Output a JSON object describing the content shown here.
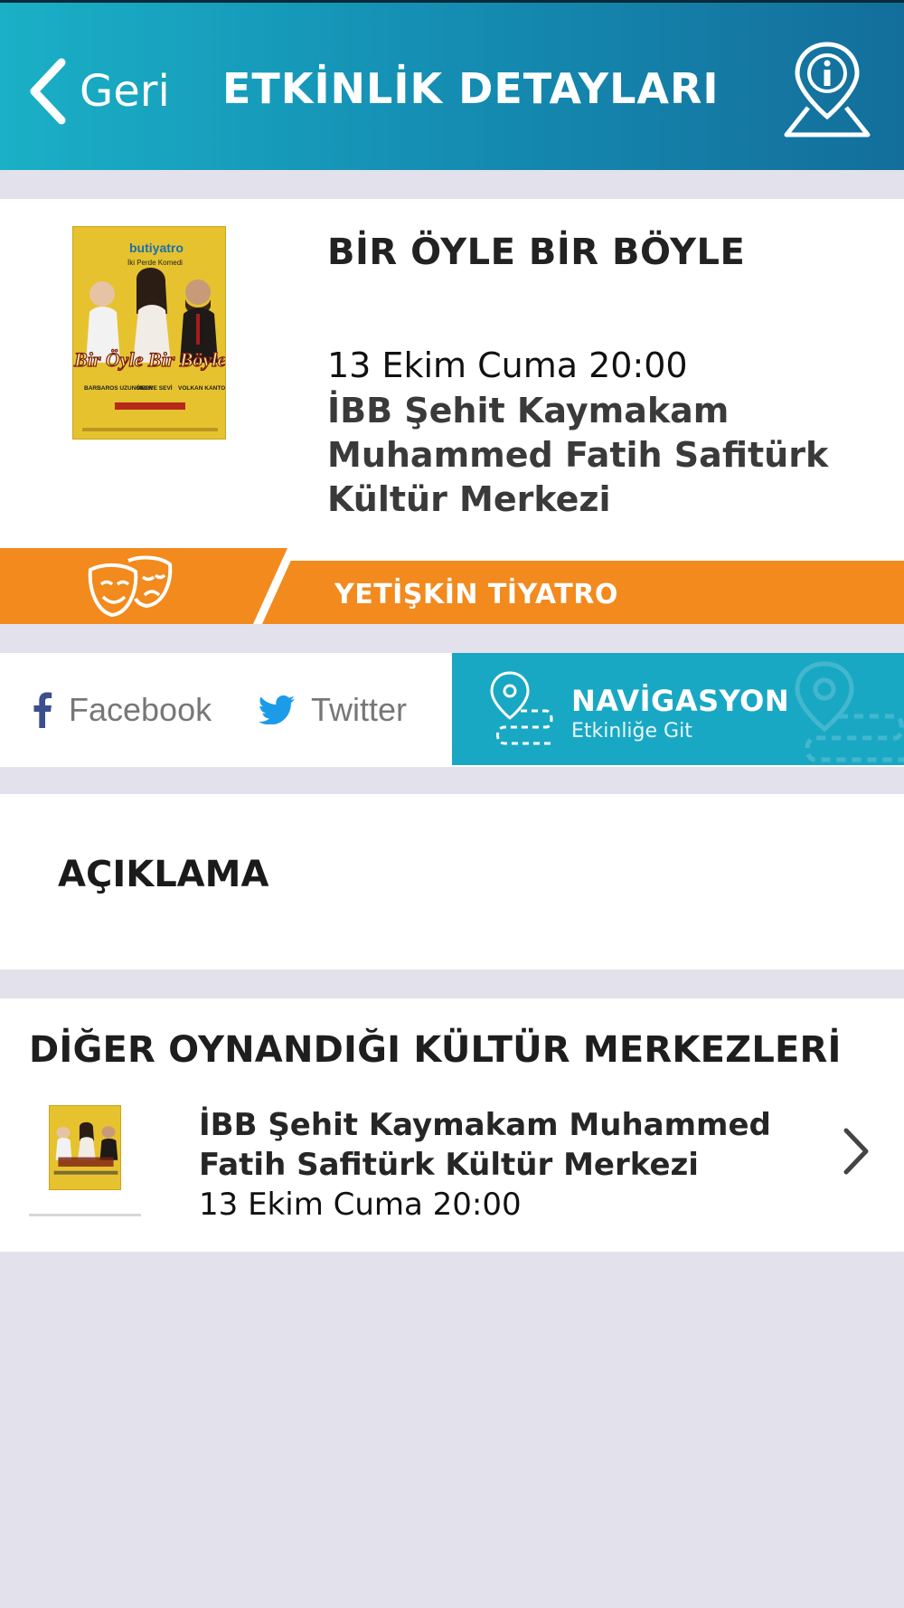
{
  "header": {
    "back_label": "Geri",
    "title": "ETKİNLİK DETAYLARI",
    "info_icon": "map-pin-info-icon"
  },
  "event": {
    "name": "BİR ÖYLE BİR BÖYLE",
    "date": "13 Ekim Cuma 20:00",
    "venue": "İBB Şehit Kaymakam Muhammed Fatih Safitürk Kültür Merkezi",
    "poster": {
      "brand": "butiyatro",
      "tagline": "İki Perde Komedi",
      "title": "Bir Öyle Bir Böyle",
      "cast": [
        "BARBAROS UZUNÖNER",
        "MERVE SEVİ",
        "VOLKAN KANTOĞLU"
      ]
    }
  },
  "category": {
    "label": "YETİŞKİN TİYATRO",
    "icon": "theater-masks-icon",
    "color": "#f28a1e"
  },
  "share": {
    "facebook_label": "Facebook",
    "twitter_label": "Twitter"
  },
  "navigation": {
    "title": "NAVİGASYON",
    "subtitle": "Etkinliğe Git",
    "color": "#19a8c4"
  },
  "description": {
    "title": "AÇIKLAMA"
  },
  "other_venues": {
    "title": "DİĞER OYNANDIĞI KÜLTÜR MERKEZLERİ",
    "items": [
      {
        "venue": "İBB Şehit Kaymakam Muhammed Fatih Safitürk Kültür Merkezi",
        "date": "13 Ekim Cuma 20:00"
      }
    ]
  }
}
